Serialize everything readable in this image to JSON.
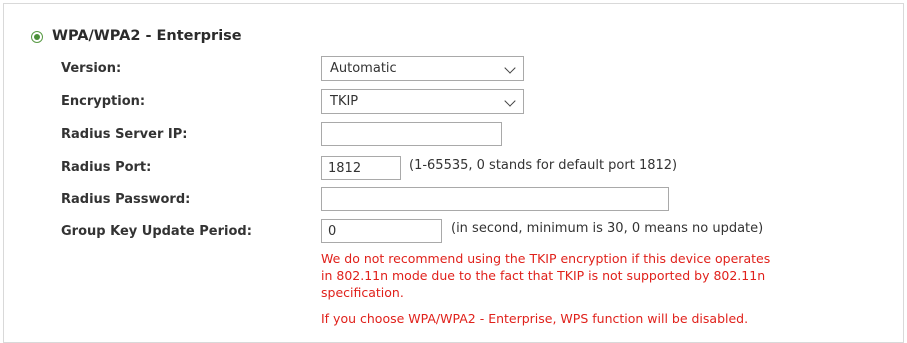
{
  "section": {
    "title": "WPA/WPA2 - Enterprise",
    "selected": true
  },
  "fields": {
    "version": {
      "label": "Version:",
      "value": "Automatic"
    },
    "encryption": {
      "label": "Encryption:",
      "value": "TKIP"
    },
    "radius_server_ip": {
      "label": "Radius Server IP:",
      "value": ""
    },
    "radius_port": {
      "label": "Radius Port:",
      "value": "1812",
      "hint": "(1-65535, 0 stands for default port 1812)"
    },
    "radius_password": {
      "label": "Radius Password:",
      "value": ""
    },
    "group_key_update": {
      "label": "Group Key Update Period:",
      "value": "0",
      "hint": "(in second, minimum is 30, 0 means no update)"
    }
  },
  "warnings": {
    "tkip_line1": "We do not recommend using the TKIP encryption if this device operates",
    "tkip_line2": "in 802.11n mode due to the fact that TKIP is not supported by 802.11n",
    "tkip_line3": "specification.",
    "wps": "If you choose WPA/WPA2 - Enterprise, WPS function will be disabled."
  },
  "colors": {
    "warning": "#e0211b",
    "radio": "#4b8f39",
    "border": "#a9a9a9"
  }
}
